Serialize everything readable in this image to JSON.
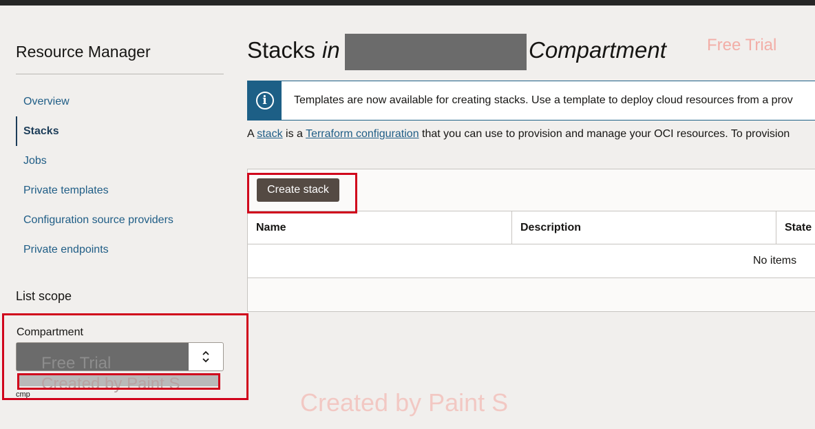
{
  "sidebar": {
    "title": "Resource Manager",
    "items": [
      {
        "label": "Overview"
      },
      {
        "label": "Stacks"
      },
      {
        "label": "Jobs"
      },
      {
        "label": "Private templates"
      },
      {
        "label": "Configuration source providers"
      },
      {
        "label": "Private endpoints"
      }
    ],
    "active_item": "Stacks",
    "list_scope": "List scope",
    "compartment_label": "Compartment",
    "compartment_hint": "cmp"
  },
  "header": {
    "title_main": "Stacks",
    "title_in": "in",
    "title_suffix": "Compartment"
  },
  "watermarks": {
    "free_trial": "Free Trial",
    "created_by": "Created by Paint S"
  },
  "banner": {
    "icon": "info-icon",
    "text": "Templates are now available for creating stacks. Use a template to deploy cloud resources from a prov"
  },
  "description": {
    "prefix": "A ",
    "link_stack": "stack",
    "mid": " is a ",
    "link_terraform": "Terraform configuration",
    "suffix": " that you can use to provision and manage your OCI resources. To provision"
  },
  "toolbar": {
    "create_label": "Create stack"
  },
  "table": {
    "columns": [
      "Name",
      "Description",
      "State"
    ],
    "empty_text": "No items"
  },
  "colors": {
    "accent": "#1d5f86",
    "highlight": "#d0021b",
    "button": "#544a43"
  }
}
